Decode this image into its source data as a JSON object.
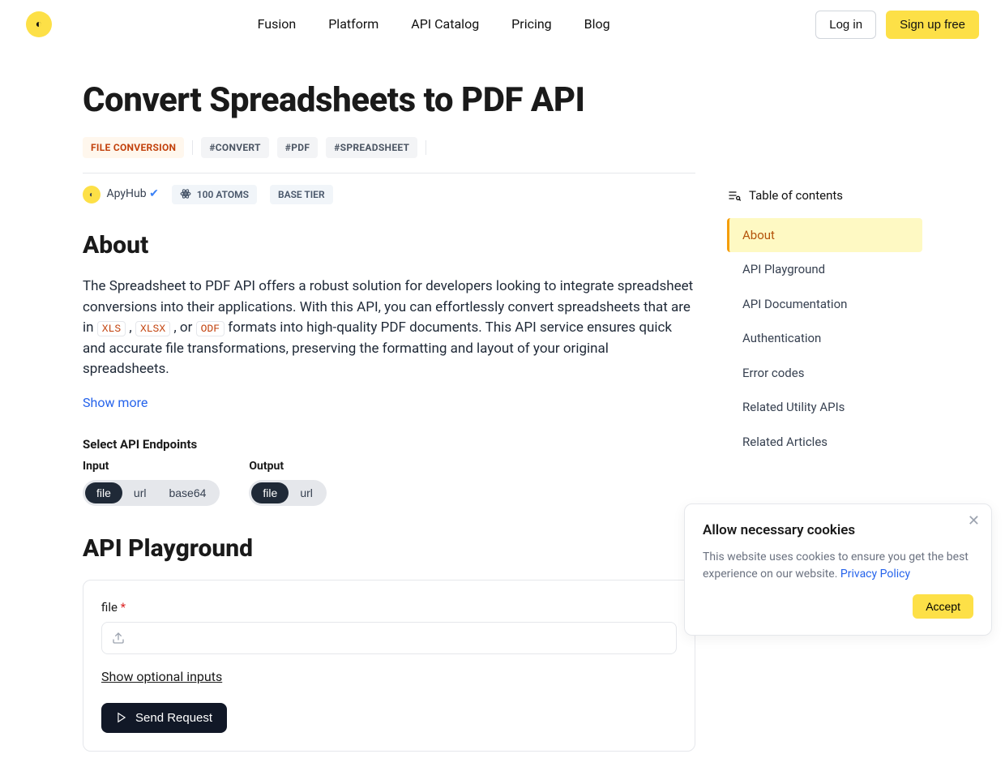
{
  "nav": {
    "links": [
      "Fusion",
      "Platform",
      "API Catalog",
      "Pricing",
      "Blog"
    ],
    "login": "Log in",
    "signup": "Sign up free"
  },
  "page": {
    "title": "Convert Spreadsheets to PDF API",
    "category": "FILE CONVERSION",
    "tags": [
      "#CONVERT",
      "#PDF",
      "#SPREADSHEET"
    ],
    "author": "ApyHub",
    "atoms": "100 ATOMS",
    "tier": "BASE TIER"
  },
  "about": {
    "heading": "About",
    "body_pre": "The Spreadsheet to PDF API offers a robust solution for developers looking to integrate spreadsheet conversions into their applications. With this API, you can effortlessly convert spreadsheets that are in ",
    "fmt1": "XLS",
    "sep1": " , ",
    "fmt2": "XLSX",
    "sep2": " , or ",
    "fmt3": "ODF",
    "body_post": " formats into high-quality PDF documents. This API service ensures quick and accurate file transformations, preserving the formatting and layout of your original spreadsheets.",
    "show_more": "Show more"
  },
  "endpoints": {
    "heading": "Select API Endpoints",
    "input_label": "Input",
    "output_label": "Output",
    "input_opts": [
      "file",
      "url",
      "base64"
    ],
    "output_opts": [
      "file",
      "url"
    ],
    "input_active": "file",
    "output_active": "file"
  },
  "playground": {
    "heading": "API Playground",
    "field_label": "file",
    "required_mark": "*",
    "show_optional": "Show optional inputs",
    "send": "Send Request"
  },
  "toc": {
    "heading": "Table of contents",
    "items": [
      "About",
      "API Playground",
      "API Documentation",
      "Authentication",
      "Error codes",
      "Related Utility APIs",
      "Related Articles"
    ],
    "active": "About"
  },
  "cookie": {
    "title": "Allow necessary cookies",
    "body": "This website uses cookies to ensure you get the best experience on our website. ",
    "link": "Privacy Policy",
    "accept": "Accept"
  }
}
